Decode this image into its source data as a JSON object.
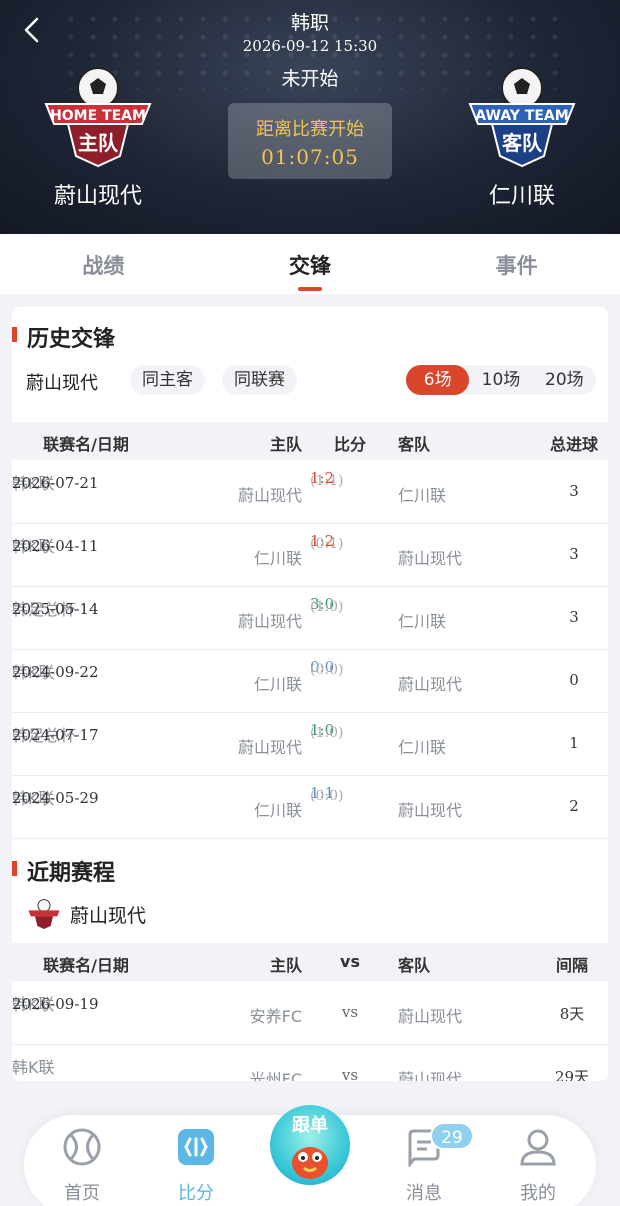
{
  "header": {
    "league": "韩职",
    "datetime": "2026-09-12 15:30",
    "status": "未开始",
    "countdown_label": "距离比赛开始",
    "countdown_time": "01:07:05",
    "home_team": "蔚山现代",
    "away_team": "仁川联",
    "home_badge_text": "HOME TEAM",
    "home_badge_sub": "主队",
    "away_badge_text": "AWAY TEAM",
    "away_badge_sub": "客队"
  },
  "tabs": [
    {
      "label": "战绩",
      "active": false
    },
    {
      "label": "交锋",
      "active": true
    },
    {
      "label": "事件",
      "active": false
    }
  ],
  "h2h": {
    "title": "历史交锋",
    "team_filter": "蔚山现代",
    "chip_same_home_away": "同主客",
    "chip_same_league": "同联赛",
    "count_options": [
      "6场",
      "10场",
      "20场"
    ],
    "selected_count": "6场",
    "columns": {
      "league_date": "联赛名/日期",
      "home": "主队",
      "score": "比分",
      "away": "客队",
      "total": "总进球"
    },
    "rows": [
      {
        "league": "韩K联",
        "date": "2026-07-21",
        "home": "蔚山现代",
        "score": "1:2",
        "half": "(1:1)",
        "away": "仁川联",
        "total": "3",
        "result": "lose"
      },
      {
        "league": "韩K联",
        "date": "2026-04-11",
        "home": "仁川联",
        "score": "1:2",
        "half": "(0:1)",
        "away": "蔚山现代",
        "total": "3",
        "result": "lose"
      },
      {
        "league": "韩足总杯",
        "date": "2025-05-14",
        "home": "蔚山现代",
        "score": "3:0",
        "half": "(1:0)",
        "away": "仁川联",
        "total": "3",
        "result": "win"
      },
      {
        "league": "韩K联",
        "date": "2024-09-22",
        "home": "仁川联",
        "score": "0:0",
        "half": "(0:0)",
        "away": "蔚山现代",
        "total": "0",
        "result": "draw"
      },
      {
        "league": "韩足总杯",
        "date": "2024-07-17",
        "home": "蔚山现代",
        "score": "1:0",
        "half": "(1:0)",
        "away": "仁川联",
        "total": "1",
        "result": "win"
      },
      {
        "league": "韩K联",
        "date": "2024-05-29",
        "home": "仁川联",
        "score": "1:1",
        "half": "(0:0)",
        "away": "蔚山现代",
        "total": "2",
        "result": "draw"
      }
    ]
  },
  "recent": {
    "title": "近期赛程",
    "team": "蔚山现代",
    "columns": {
      "league_date": "联赛名/日期",
      "home": "主队",
      "vs": "vs",
      "away": "客队",
      "gap": "间隔"
    },
    "rows": [
      {
        "league": "韩K联",
        "date": "2026-09-19",
        "home": "安养FC",
        "vs": "vs",
        "away": "蔚山现代",
        "gap": "8天"
      },
      {
        "league": "韩K联",
        "date": "",
        "home": "光州FC",
        "vs": "vs",
        "away": "蔚山现代",
        "gap": "29天"
      }
    ]
  },
  "nav": {
    "items": [
      "首页",
      "比分",
      "跟单",
      "消息",
      "我的"
    ],
    "active": "比分",
    "message_count": "29"
  }
}
